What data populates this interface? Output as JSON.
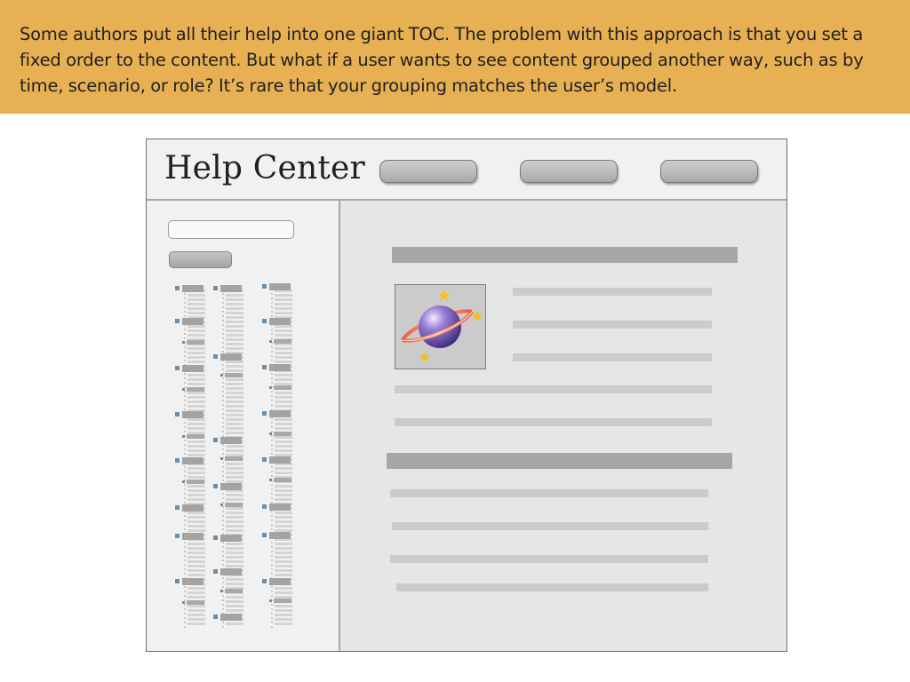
{
  "banner": {
    "text": "Some authors put all their help into one giant TOC. The problem with this approach is that you set a fixed order to the content. But what if a user wants to see content grouped another way, such as by time, scenario, or role? It’s rare that your grouping matches the user’s model.",
    "background": "#e6b053"
  },
  "window": {
    "title": "Help Center",
    "nav_buttons": [
      "nav-button-1",
      "nav-button-2",
      "nav-button-3"
    ]
  },
  "sidebar": {
    "search_input": "",
    "search_button": ""
  },
  "content": {
    "image_icon": "planet-icon"
  },
  "colors": {
    "heading_bar": "#a6a6a6",
    "text_bar": "#cbcbcb",
    "toc_bullet": "#6b8fa8"
  }
}
